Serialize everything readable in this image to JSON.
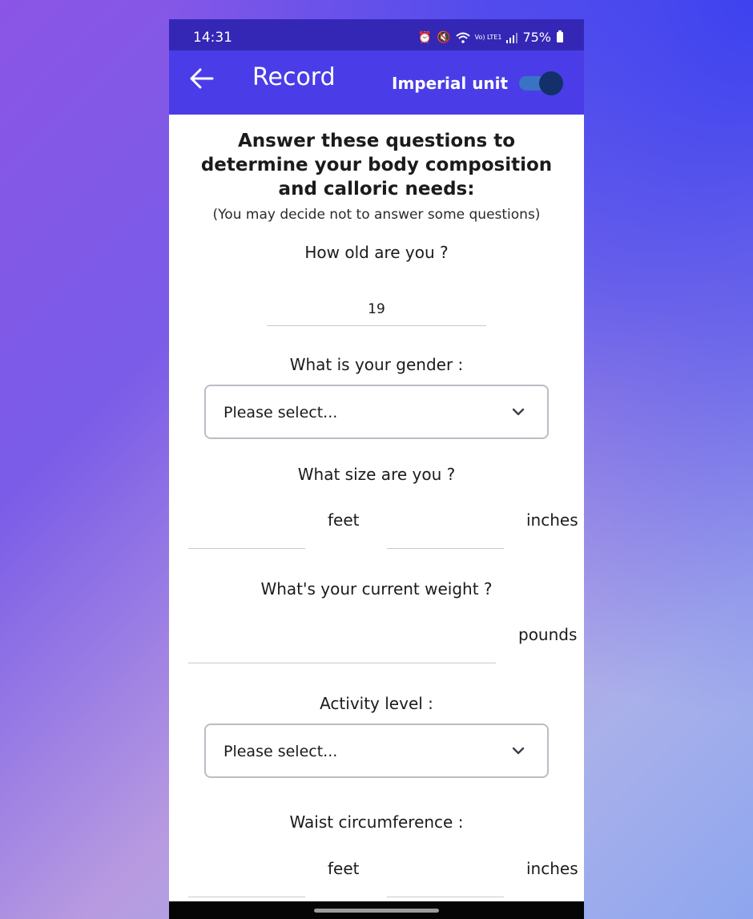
{
  "status_bar": {
    "time": "14:31",
    "network_label": "Vo) LTE1",
    "battery": "75%",
    "icons": [
      "alarm-icon",
      "mute-icon",
      "wifi-icon",
      "signal-icon",
      "battery-icon"
    ]
  },
  "app_bar": {
    "back_icon": "arrow-left-icon",
    "title": "Record",
    "unit_label": "Imperial unit",
    "unit_toggle_on": true
  },
  "intro": {
    "heading": "Answer these questions to determine your body composition and calloric needs:",
    "note": "(You may decide not to answer some questions)"
  },
  "questions": {
    "age": {
      "label": "How old are you ?",
      "value": "19"
    },
    "gender": {
      "label": "What is your gender :",
      "selected": "Please select..."
    },
    "size": {
      "label": "What size are you ?",
      "feet_value": "",
      "feet_unit": "feet",
      "inches_value": "",
      "inches_unit": "inches"
    },
    "weight": {
      "label": "What's your current weight ?",
      "value": "",
      "unit": "pounds"
    },
    "activity": {
      "label": "Activity level :",
      "selected": "Please select..."
    },
    "waist": {
      "label": "Waist circumference :",
      "feet_value": "",
      "feet_unit": "feet",
      "inches_value": "",
      "inches_unit": "inches"
    }
  },
  "colors": {
    "status_bar": "#3427b6",
    "app_bar": "#4a3de8",
    "toggle_track": "#3a73c4",
    "toggle_thumb": "#13306a",
    "select_border": "#b9bec5"
  }
}
